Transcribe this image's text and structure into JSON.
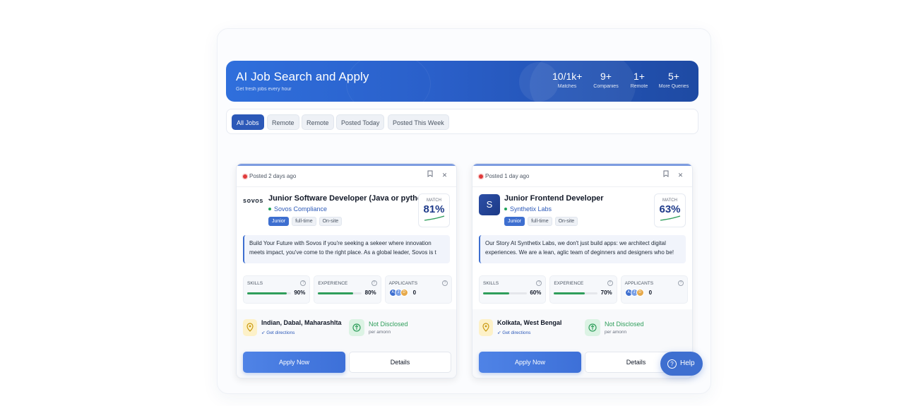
{
  "hero": {
    "title": "AI Job Search and Apply",
    "subtitle": "Get fresh jobs every hour",
    "stats": [
      {
        "value": "10/1k+",
        "label": "Matches"
      },
      {
        "value": "9+",
        "label": "Companies"
      },
      {
        "value": "1+",
        "label": "Remote"
      },
      {
        "value": "5+",
        "label": "More Queries"
      }
    ]
  },
  "filters": [
    "All Jobs",
    "Remote",
    "Remote",
    "Posted Today",
    "Posted This Week"
  ],
  "labels": {
    "match": "MATCH",
    "skills": "SKILLS",
    "experience": "EXPERIENCE",
    "applicants": "APPLICANTS",
    "get_directions": "Get directions",
    "per_annum": "per amonn",
    "apply": "Apply Now",
    "details": "Details",
    "help": "Help"
  },
  "jobs": [
    {
      "posted": "Posted 2 days ago",
      "logo_text": "sovos",
      "title": "Junior Software Developer (Java or python)",
      "company": "Sovos Compliance",
      "tags": [
        "Junior",
        "full-time",
        "On-site"
      ],
      "match": "81%",
      "description": "Build Your Future with Sovos if you're seeking a sekeer where innovation meets impact, you've come to the right place. As a global leader, Sovos is t",
      "skills": "90%",
      "skills_value": 0.9,
      "experience": "80%",
      "experience_value": 0.8,
      "applicant_initials": [
        "A",
        "J",
        "D"
      ],
      "applicants": "0",
      "location": "Indian, Dabal, Maharashlta",
      "salary": "Not Disclosed"
    },
    {
      "posted": "Posted 1 day ago",
      "logo_text": "S",
      "title": "Junior Frontend Developer",
      "company": "Synthetix Labs",
      "tags": [
        "Junior",
        "full-time",
        "On-site"
      ],
      "match": "63%",
      "description": "Our Story At Synthetix Labs, we don't just build apps: we architect digital experiences. We are a lean, aglic team of deginners and designers who be!",
      "skills": "60%",
      "skills_value": 0.6,
      "experience": "70%",
      "experience_value": 0.7,
      "applicant_initials": [
        "A",
        "J",
        "D"
      ],
      "applicants": "0",
      "location": "Kolkata, West Bengal",
      "salary": "Not Disclosed"
    }
  ],
  "colors": {
    "accent": "#2c59b8",
    "success": "#2f9e5b",
    "posted_dot": "#e03a3a"
  }
}
